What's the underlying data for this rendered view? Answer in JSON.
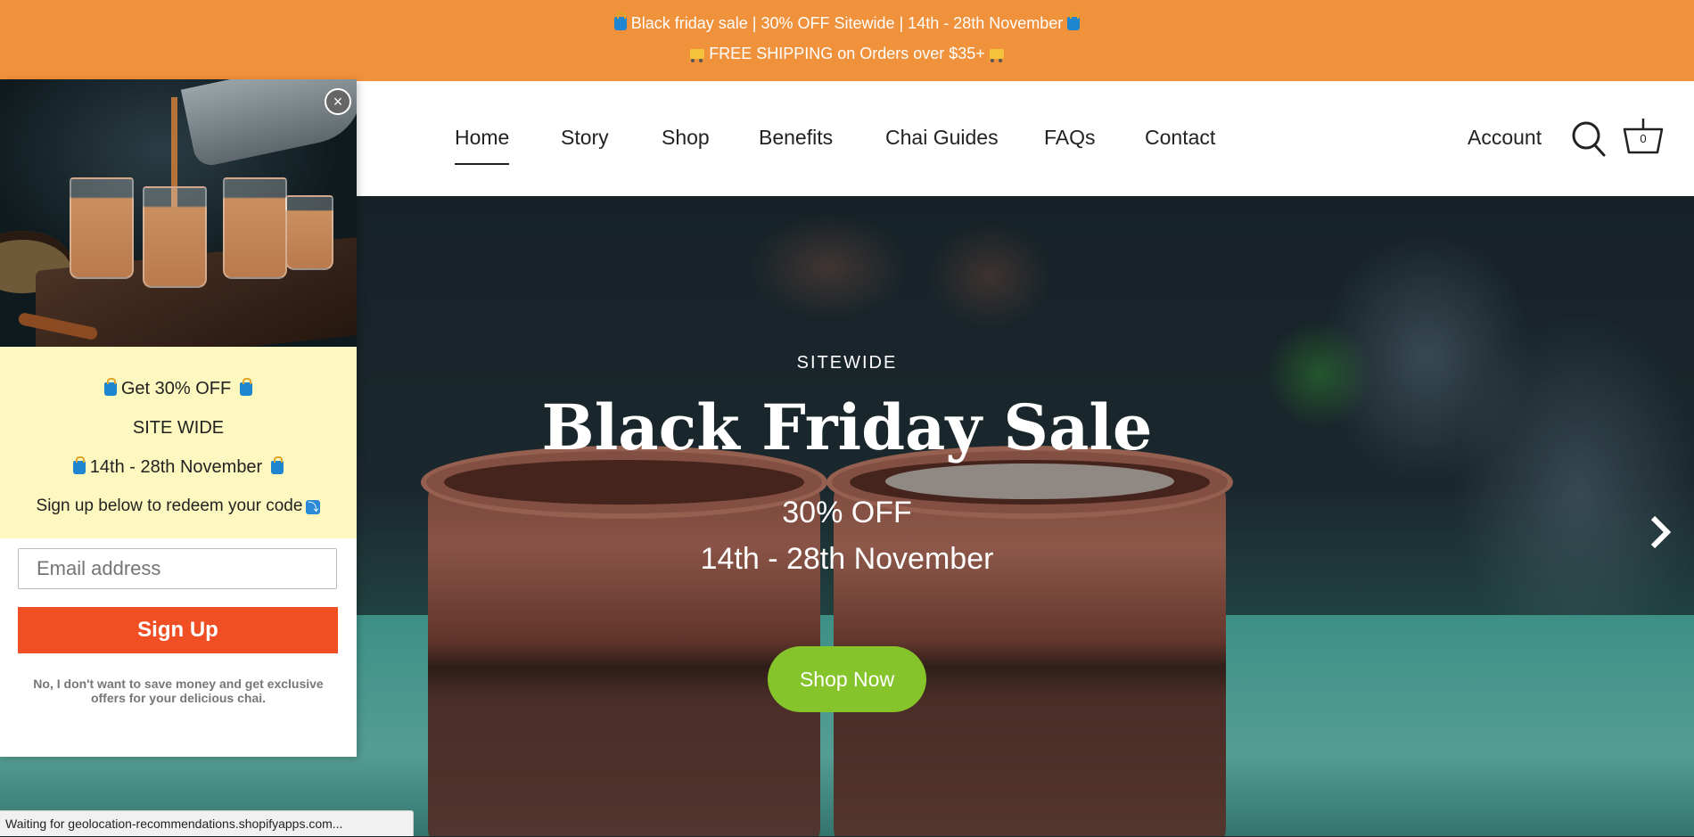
{
  "announcement": {
    "line1": "Black friday sale | 30% OFF Sitewide | 14th - 28th November",
    "line2": "FREE SHIPPING on Orders over $35+"
  },
  "nav": {
    "items": [
      {
        "label": "Home",
        "active": true
      },
      {
        "label": "Story"
      },
      {
        "label": "Shop"
      },
      {
        "label": "Benefits"
      },
      {
        "label": "Chai Guides"
      },
      {
        "label": "FAQs"
      },
      {
        "label": "Contact"
      }
    ],
    "account_label": "Account",
    "cart_count": "0"
  },
  "hero": {
    "kicker": "SITEWIDE",
    "title": "Black Friday Sale",
    "sub1": "30% OFF",
    "sub2": "14th - 28th November",
    "cta": "Shop Now"
  },
  "popup": {
    "close_symbol": "×",
    "promo_line1": "Get 30% OFF",
    "promo_line2": "SITE WIDE",
    "promo_line3": "14th - 28th  November",
    "promo_line4": "Sign up below to redeem your code",
    "email_placeholder": "Email address",
    "signup_label": "Sign Up",
    "decline_text": "No, I don't want to save money and get exclusive offers for your delicious chai."
  },
  "status_bar": {
    "text": "Waiting for geolocation-recommendations.shopifyapps.com..."
  },
  "colors": {
    "announcement_bg": "#f0913c",
    "shop_now_bg": "#86c42b",
    "signup_bg": "#f04e23",
    "promo_bg": "#fdf8bf"
  }
}
